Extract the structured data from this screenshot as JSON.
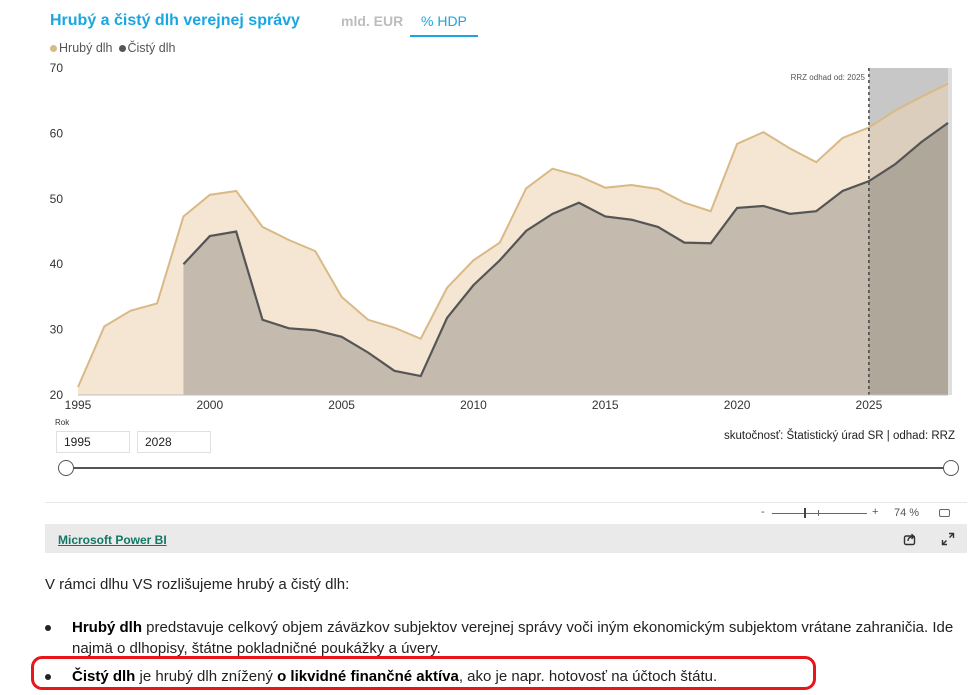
{
  "header": {
    "title": "Hrubý a čistý dlh verejnej správy",
    "tabs": [
      {
        "label": "mld. EUR",
        "active": false
      },
      {
        "label": "% HDP",
        "active": true
      }
    ],
    "accent_color": "#1aa6e0"
  },
  "legend": [
    {
      "label": "Hrubý dlh",
      "color": "#d9b985"
    },
    {
      "label": "Čistý dlh",
      "color": "#555555"
    }
  ],
  "chart_data": {
    "type": "area",
    "xlabel": "Rok",
    "ylim": [
      20,
      70
    ],
    "y_ticks": [
      20,
      30,
      40,
      50,
      60,
      70
    ],
    "x_ticks": [
      1995,
      2000,
      2005,
      2010,
      2015,
      2020,
      2025
    ],
    "x_range": [
      1995,
      2028
    ],
    "forecast_from": 2025,
    "forecast_label": "RRZ odhad od: 2025",
    "grid": false,
    "legend_position": "top-left",
    "series": [
      {
        "name": "Hrubý dlh",
        "color": "#d9b985",
        "fill": "#f5e6d3",
        "x": [
          1995,
          1996,
          1997,
          1998,
          1999,
          2000,
          2001,
          2002,
          2003,
          2004,
          2005,
          2006,
          2007,
          2008,
          2009,
          2010,
          2011,
          2012,
          2013,
          2014,
          2015,
          2016,
          2017,
          2018,
          2019,
          2020,
          2021,
          2022,
          2023,
          2024,
          2025,
          2026,
          2027,
          2028
        ],
        "values": [
          21.2,
          30.5,
          32.9,
          34.0,
          47.3,
          50.6,
          51.2,
          45.7,
          43.7,
          42.0,
          35.0,
          31.5,
          30.3,
          28.6,
          36.4,
          40.6,
          43.3,
          51.6,
          54.6,
          53.5,
          51.7,
          52.1,
          51.5,
          49.4,
          48.1,
          58.4,
          60.2,
          57.7,
          55.6,
          59.3,
          60.9,
          63.5,
          65.6,
          67.6
        ]
      },
      {
        "name": "Čistý dlh",
        "color": "#555555",
        "fill": "#c2b8ab",
        "x": [
          1999,
          2000,
          2001,
          2002,
          2003,
          2004,
          2005,
          2006,
          2007,
          2008,
          2009,
          2010,
          2011,
          2012,
          2013,
          2014,
          2015,
          2016,
          2017,
          2018,
          2019,
          2020,
          2021,
          2022,
          2023,
          2024,
          2025,
          2026,
          2027,
          2028
        ],
        "values": [
          40.0,
          44.3,
          45.0,
          31.5,
          30.2,
          29.9,
          28.9,
          26.5,
          23.7,
          22.9,
          31.8,
          36.8,
          40.6,
          45.1,
          47.7,
          49.4,
          47.3,
          46.8,
          45.7,
          43.3,
          43.2,
          48.6,
          48.9,
          47.7,
          48.1,
          51.2,
          52.7,
          55.3,
          58.7,
          61.6
        ]
      }
    ]
  },
  "range": {
    "label": "Rok",
    "from": "1995",
    "to": "2028"
  },
  "source_text": "skutočnosť: Štatistický úrad SR | odhad: RRZ",
  "zoom": {
    "minus": "-",
    "plus": "+",
    "level": "74 %"
  },
  "footer": {
    "link_label": "Microsoft Power BI",
    "icons": [
      "share-icon",
      "expand-icon"
    ]
  },
  "article": {
    "intro": "V rámci dlhu VS rozlišujeme hrubý a čistý dlh:",
    "bullet1": {
      "term": "Hrubý dlh",
      "text": " predstavuje celkový objem záväzkov subjektov verejnej správy voči iným ekonomickým subjektom vrátane zahraničia. Ide najmä o dlhopisy, štátne pokladničné poukážky a úvery."
    },
    "bullet2": {
      "term": "Čistý dlh",
      "text_before": " je hrubý dlh znížený ",
      "emphasis": "o likvidné finančné aktíva",
      "text_after": ", ako je napr. hotovosť na účtoch štátu."
    },
    "highlight_color": "#e8161b"
  }
}
